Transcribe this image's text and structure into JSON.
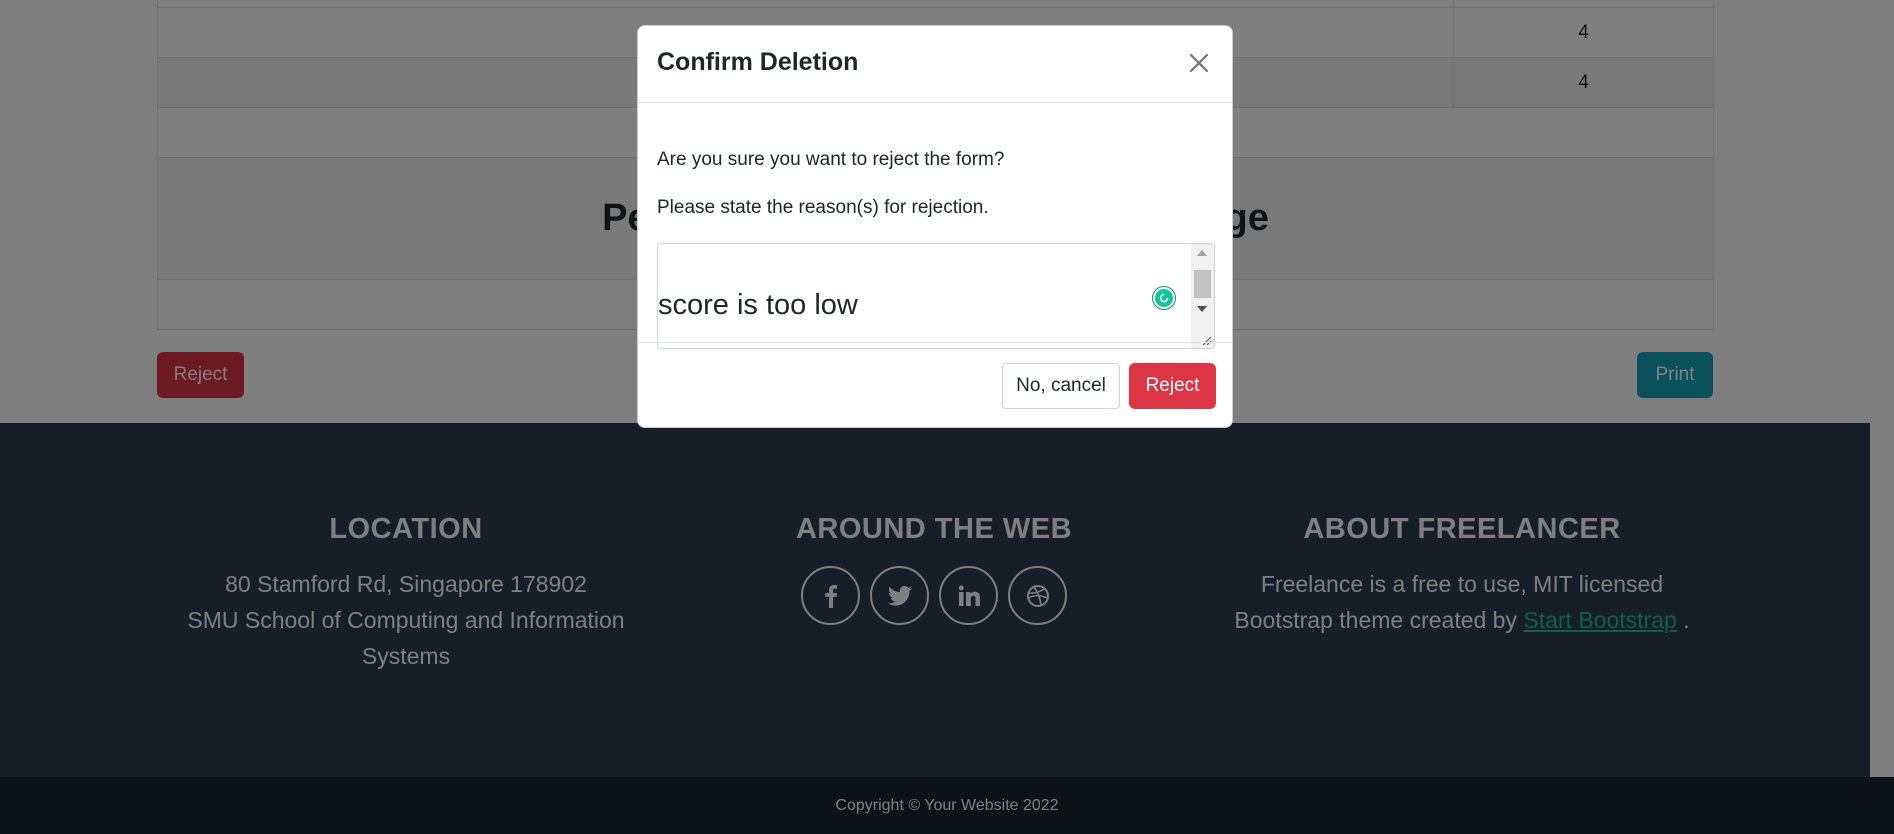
{
  "table": {
    "rows": [
      {
        "label": "",
        "value": "4"
      },
      {
        "label": "",
        "value": "4"
      }
    ],
    "heading_left": "Per",
    "heading_right": "age"
  },
  "page_buttons": {
    "reject_label": "Reject",
    "print_label": "Print"
  },
  "footer": {
    "location": {
      "title": "LOCATION",
      "line1": "80 Stamford Rd, Singapore 178902",
      "line2": "SMU School of Computing and Information",
      "line3": "Systems"
    },
    "web": {
      "title": "AROUND THE WEB",
      "icons": [
        "facebook-icon",
        "twitter-icon",
        "linkedin-icon",
        "dribbble-icon"
      ]
    },
    "about": {
      "title": "ABOUT FREELANCER",
      "line1": "Freelance is a free to use, MIT licensed",
      "line2_prefix": "Bootstrap theme created by",
      "link_text": "Start Bootstrap",
      "line2_suffix": "."
    },
    "copyright": "Copyright © Your Website 2022"
  },
  "modal": {
    "title": "Confirm Deletion",
    "question": "Are you sure you want to reject the form?",
    "reason_prompt": "Please state the reason(s) for rejection.",
    "reason_value": "score is too low",
    "cancel_label": "No, cancel",
    "reject_label": "Reject"
  },
  "colors": {
    "danger": "#dc3545",
    "info": "#17a2b8",
    "footer_bg": "#2c3e50",
    "copyright_bg": "#1a252f",
    "accent": "#1abc9c"
  }
}
